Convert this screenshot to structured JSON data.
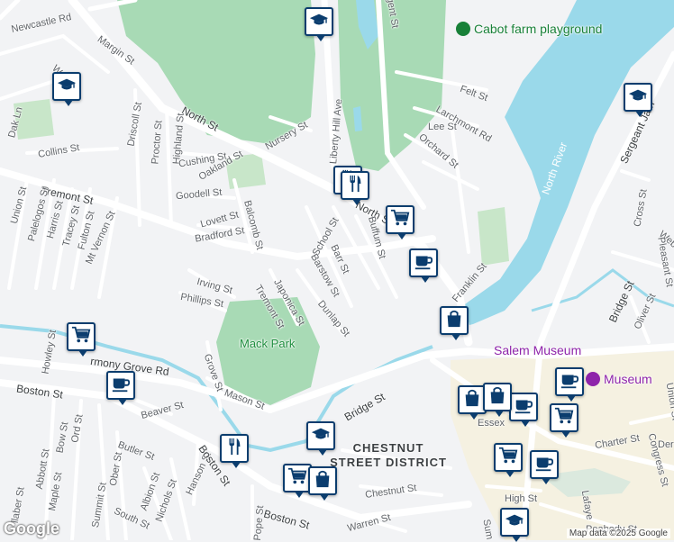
{
  "map": {
    "attribution": "Map data ©2025 Google",
    "logo_text": "Google",
    "colors": {
      "water": "#9ad9ea",
      "park": "#a8dab5",
      "road": "#ffffff",
      "marker_border": "#0b3d6e"
    },
    "labels": {
      "newcastle": "Newcastle Rd",
      "margin": "Margin St",
      "north_st_w": "North St",
      "north_st_e": "North St",
      "nursery": "Nursery St",
      "liberty": "Liberty Hill Ave",
      "gent": "gent St",
      "driscoll": "Driscoll St",
      "proctor": "Proctor St",
      "highland": "Highland St",
      "collins": "Collins St",
      "cushing": "Cushing St",
      "oakland": "Oakland St",
      "goodell": "Goodell St",
      "tremont_n": "Tremont St",
      "union": "Union St",
      "palelogos": "Palelogos St",
      "harris": "Harris St",
      "tracey": "Tracey St",
      "fulton": "Fulton St",
      "mt_vernon": "Mt Vernon St",
      "lovett": "Lovett St",
      "bradford": "Bradford St",
      "balcomb": "Balcomb St",
      "school": "School St",
      "buffum": "Buffum St",
      "barr": "Barr St",
      "barstow": "Barstow St",
      "irving": "Irving St",
      "phillips": "Phillips St",
      "japonica": "Japonica St",
      "tremont_s": "Tremont St",
      "dunlap": "Dunlap St",
      "mack_park": "Mack Park",
      "harmony_grove": "rmony Grove Rd",
      "howley": "Howley St",
      "grove": "Grove St",
      "mason": "Mason St",
      "boston_w": "Boston St",
      "beaver": "Beaver St",
      "bow": "Bow St",
      "ord": "Ord St",
      "butler": "Butler St",
      "ober": "Ober St",
      "abbott": "Abbott St",
      "maple": "Maple St",
      "llaber": "llaber St",
      "summit": "Summit St",
      "albion": "Albion St",
      "nichols": "Nichols St",
      "south": "South St",
      "hanson": "Hanson St",
      "boston_c": "Boston St",
      "boston_s": "Boston St",
      "pope": "Pope St",
      "warren": "Warren St",
      "bridge_w": "Bridge St",
      "chestnut_district": "CHESTNUT STREET DISTRICT",
      "chestnut": "Chestnut St",
      "high": "High St",
      "sum": "Sum",
      "essex": "Essex",
      "lafayette": "Lafaye",
      "peabody": "Peabody St",
      "congress": "Congress St",
      "charter": "Charter St",
      "der": "Der",
      "union_e": "Union St",
      "salem_museum": "Salem Museum",
      "museum": "Museum",
      "felt": "Felt St",
      "larchmont": "Larchmont Rd",
      "lee": "Lee St",
      "orchard": "Orchard St",
      "north_river": "North River",
      "sergeant": "Sergeant Jam",
      "cross": "Cross St",
      "webb": "Web",
      "pleasant": "Pleasant St",
      "bridge_e": "Bridge St",
      "oliver": "Oliver St",
      "franklin": "Franklin St",
      "cabot": "Cabot farm playground",
      "dak_ln": "Dak Ln",
      "w_st": "W"
    },
    "markers": [
      {
        "name": "school-marker",
        "icon": "graduation-cap-icon"
      },
      {
        "name": "school-marker",
        "icon": "graduation-cap-icon"
      },
      {
        "name": "school-marker",
        "icon": "graduation-cap-icon"
      },
      {
        "name": "school-marker",
        "icon": "graduation-cap-icon"
      },
      {
        "name": "school-marker",
        "icon": "graduation-cap-icon"
      },
      {
        "name": "restaurant-marker",
        "icon": "fork-knife-icon"
      },
      {
        "name": "restaurant-marker",
        "icon": "fork-knife-icon"
      },
      {
        "name": "restaurant-marker",
        "icon": "fork-knife-icon"
      },
      {
        "name": "grocery-marker",
        "icon": "shopping-cart-icon"
      },
      {
        "name": "grocery-marker",
        "icon": "shopping-cart-icon"
      },
      {
        "name": "grocery-marker",
        "icon": "shopping-cart-icon"
      },
      {
        "name": "grocery-marker",
        "icon": "shopping-cart-icon"
      },
      {
        "name": "grocery-marker",
        "icon": "shopping-cart-icon"
      },
      {
        "name": "cafe-marker",
        "icon": "coffee-cup-icon"
      },
      {
        "name": "cafe-marker",
        "icon": "coffee-cup-icon"
      },
      {
        "name": "cafe-marker",
        "icon": "coffee-cup-icon"
      },
      {
        "name": "cafe-marker",
        "icon": "coffee-cup-icon"
      },
      {
        "name": "cafe-marker",
        "icon": "coffee-cup-icon"
      },
      {
        "name": "shopping-marker",
        "icon": "shopping-bag-icon"
      },
      {
        "name": "shopping-marker",
        "icon": "shopping-bag-icon"
      },
      {
        "name": "shopping-marker",
        "icon": "shopping-bag-icon"
      },
      {
        "name": "shopping-marker",
        "icon": "shopping-bag-icon"
      }
    ]
  }
}
